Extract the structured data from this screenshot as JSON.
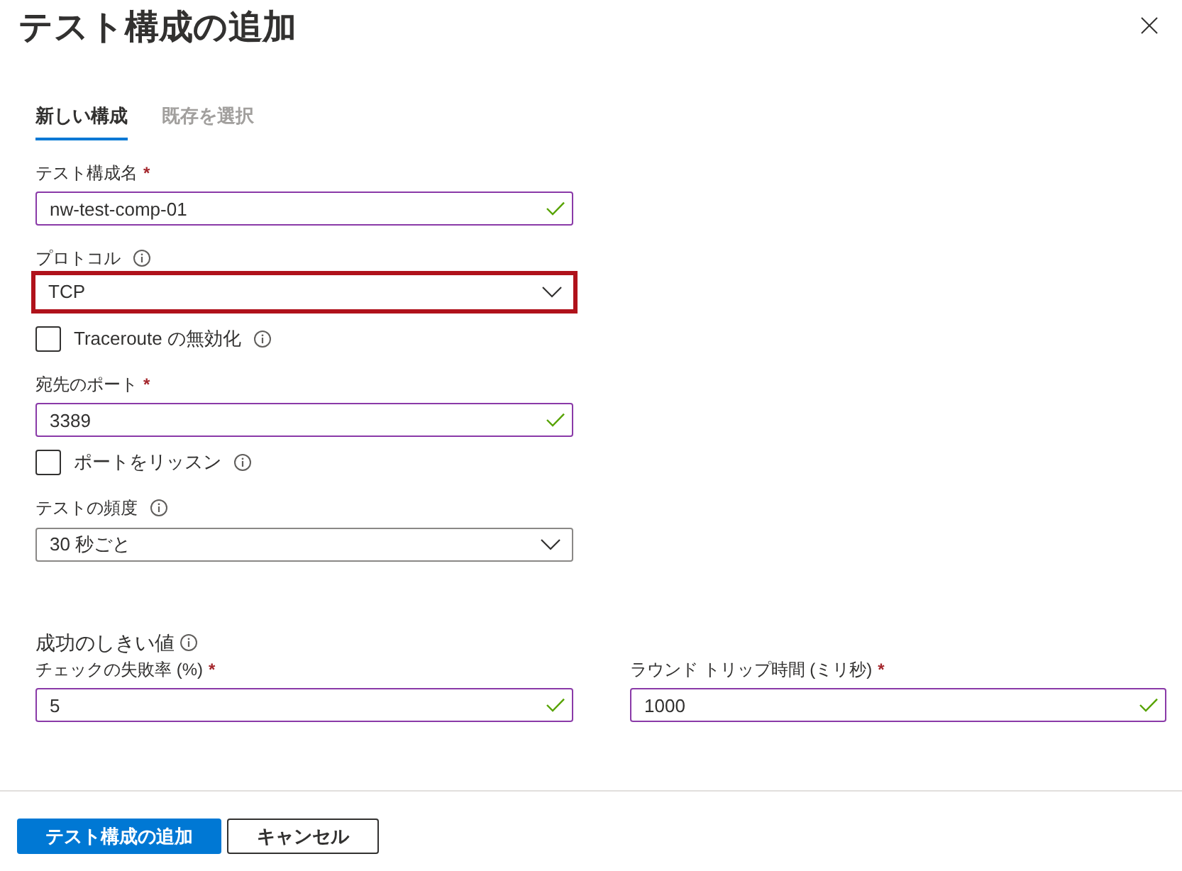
{
  "panel": {
    "title": "テスト構成の追加"
  },
  "tabs": [
    {
      "label": "新しい構成",
      "selected": true
    },
    {
      "label": "既存を選択",
      "selected": false
    }
  ],
  "fields": [
    {
      "kind": "text",
      "label": "テスト構成名",
      "required_mark": "*",
      "value": "nw-test-comp-01",
      "valid": true
    },
    {
      "kind": "select",
      "label": "プロトコル",
      "info": true,
      "value": "TCP",
      "highlighted": true
    },
    {
      "kind": "checkbox",
      "label": "Traceroute の無効化",
      "info": true,
      "checked": false
    },
    {
      "kind": "text",
      "label": "宛先のポート",
      "required_mark": "*",
      "value": "3389",
      "valid": true
    },
    {
      "kind": "checkbox",
      "label": "ポートをリッスン",
      "info": true,
      "checked": false
    },
    {
      "kind": "select",
      "label": "テストの頻度",
      "info": true,
      "value": "30 秒ごと",
      "highlighted": false
    }
  ],
  "thresholds": {
    "heading": "成功のしきい値",
    "info": true,
    "fields": [
      {
        "kind": "text",
        "label": "チェックの失敗率 (%)",
        "required_mark": "*",
        "value": "5",
        "valid": true
      },
      {
        "kind": "text",
        "label": "ラウンド トリップ時間 (ミリ秒)",
        "required_mark": "*",
        "value": "1000",
        "valid": true
      }
    ]
  },
  "buttons": [
    {
      "label": "テスト構成の追加",
      "kind": "primary"
    },
    {
      "label": "キャンセル",
      "kind": "secondary"
    }
  ]
}
